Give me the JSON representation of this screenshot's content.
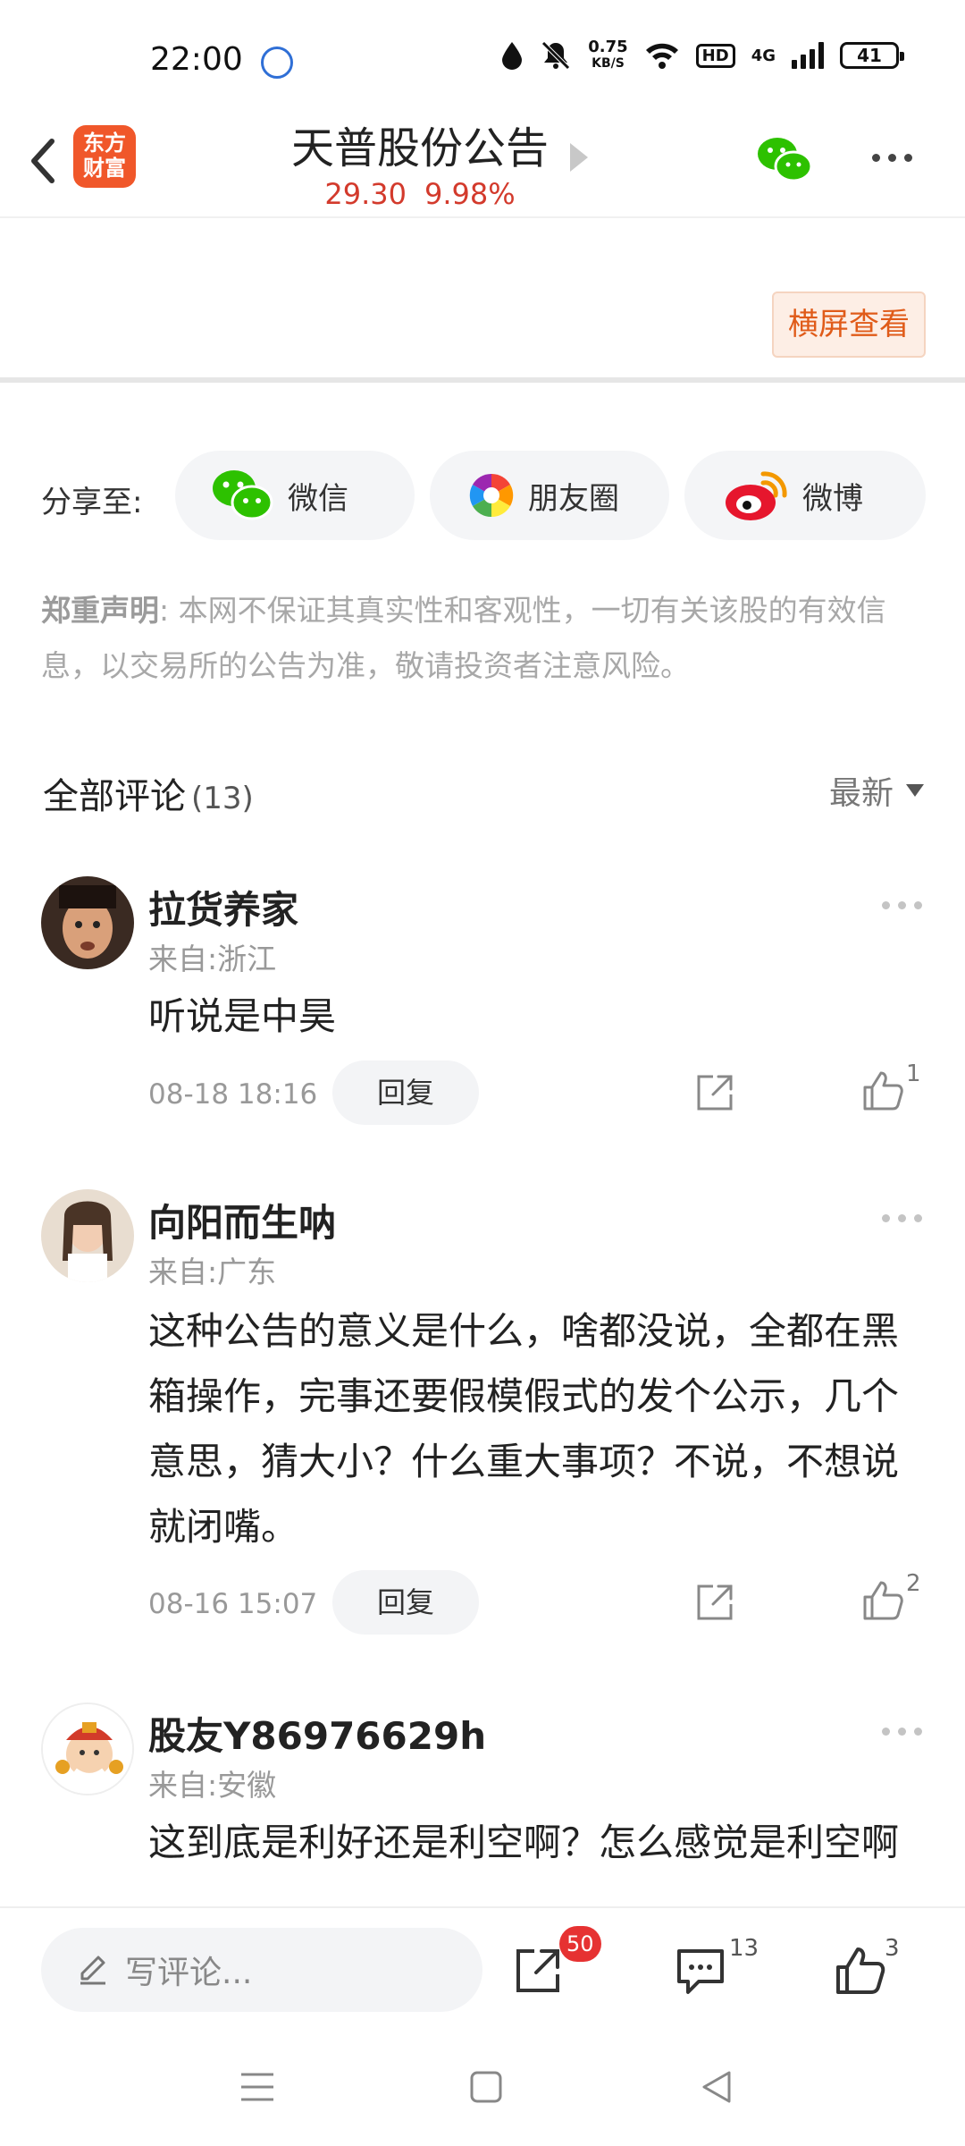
{
  "status_bar": {
    "time": "22:00",
    "net_speed_value": "0.75",
    "net_speed_unit": "KB/S",
    "hd": "HD",
    "network": "4G",
    "battery": "41"
  },
  "header": {
    "logo_line1": "东方",
    "logo_line2": "财富",
    "title": "天普股份公告",
    "price": "29.30",
    "change": "9.98%"
  },
  "landscape_button": "横屏查看",
  "share": {
    "label": "分享至:",
    "wechat": "微信",
    "moments": "朋友圈",
    "weibo": "微博"
  },
  "disclaimer": {
    "bold": "郑重声明",
    "text": ": 本网不保证其真实性和客观性，一切有关该股的有效信息，以交易所的公告为准，敬请投资者注意风险。"
  },
  "comments_header": {
    "title": "全部评论",
    "count": "(13)",
    "sort": "最新"
  },
  "comments": [
    {
      "name": "拉货养家",
      "location": "来自:浙江",
      "text": "听说是中昊",
      "time": "08-18 18:16",
      "reply": "回复",
      "likes": "1"
    },
    {
      "name": "向阳而生呐",
      "location": "来自:广东",
      "text": "这种公告的意义是什么，啥都没说，全都在黑箱操作，完事还要假模假式的发个公示，几个意思，猜大小？什么重大事项？不说，不想说就闭嘴。",
      "time": "08-16 15:07",
      "reply": "回复",
      "likes": "2"
    },
    {
      "name": "股友Y86976629h",
      "location": "来自:安徽",
      "text": "这到底是利好还是利空啊？怎么感觉是利空啊"
    }
  ],
  "bottom_bar": {
    "write_placeholder": "写评论...",
    "share_badge": "50",
    "comment_count": "13",
    "like_count": "3"
  }
}
